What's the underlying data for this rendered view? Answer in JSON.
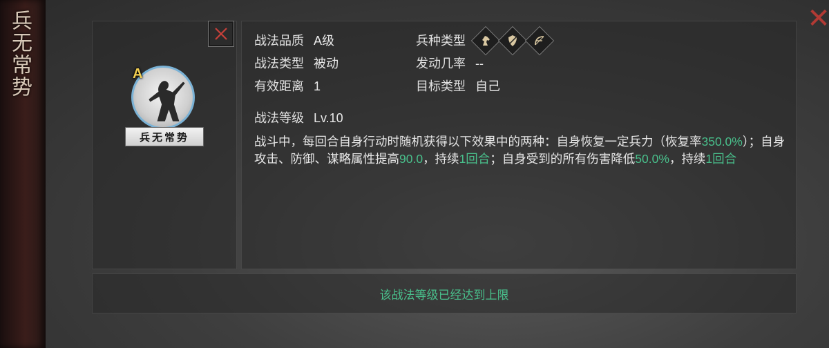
{
  "side_title": "兵无常势",
  "skill": {
    "name": "兵无常势",
    "grade_badge": "A",
    "quality_label": "战法品质",
    "quality_value": "A级",
    "type_label": "战法类型",
    "type_value": "被动",
    "range_label": "有效距离",
    "range_value": "1",
    "troop_label": "兵种类型",
    "troop_icons": [
      "cavalry-icon",
      "shield-icon",
      "bow-icon"
    ],
    "rate_label": "发动几率",
    "rate_value": "--",
    "target_label": "目标类型",
    "target_value": "自己",
    "level_label": "战法等级",
    "level_value": "Lv.10",
    "description_segments": [
      {
        "text": "战斗中，每回合自身行动时随机获得以下效果中的两种：自身恢复一定兵力（恢复率",
        "highlight": false
      },
      {
        "text": "350.0%",
        "highlight": true
      },
      {
        "text": "）；自身攻击、防御、谋略属性提高",
        "highlight": false
      },
      {
        "text": "90.0",
        "highlight": true
      },
      {
        "text": "，持续",
        "highlight": false
      },
      {
        "text": "1回合",
        "highlight": true
      },
      {
        "text": "；自身受到的所有伤害降低",
        "highlight": false
      },
      {
        "text": "50.0%",
        "highlight": true
      },
      {
        "text": "，持续",
        "highlight": false
      },
      {
        "text": "1回合",
        "highlight": true
      }
    ]
  },
  "max_level_message": "该战法等级已经达到上限",
  "colors": {
    "highlight": "#49c08c",
    "close_red": "#b23a34",
    "grade_gold": "#f2cf52",
    "portrait_ring": "#7ab2d6"
  }
}
